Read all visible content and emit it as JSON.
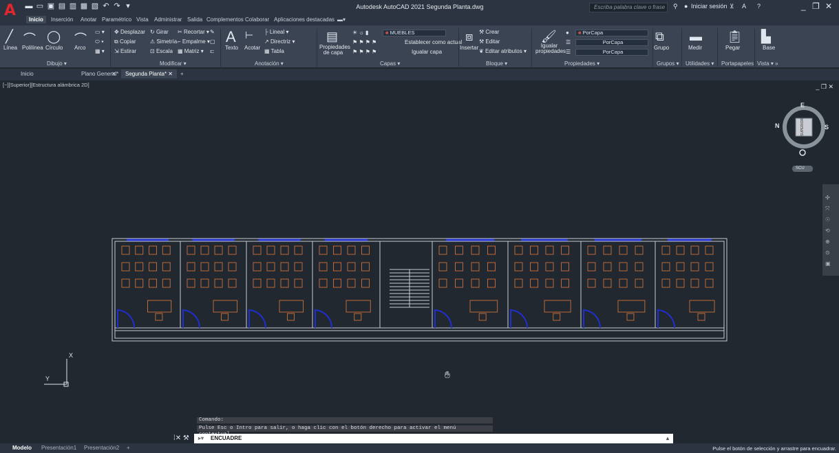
{
  "app": {
    "title": "Autodesk AutoCAD 2021   Segunda Planta.dwg",
    "logo": "A",
    "search_placeholder": "Escriba palabra clave o frase",
    "signin": "Iniciar sesión"
  },
  "ribbon_tabs": [
    "Inicio",
    "Inserción",
    "Anotar",
    "Paramétrico",
    "Vista",
    "Administrar",
    "Salida",
    "Complementos",
    "Colaborar",
    "Aplicaciones destacadas"
  ],
  "panels": {
    "dibujo": {
      "label": "Dibujo ▾",
      "tools": [
        "Línea",
        "Polilínea",
        "Círculo",
        "Arco"
      ]
    },
    "modificar": {
      "label": "Modificar ▾",
      "tools": [
        "Desplazar",
        "Girar",
        "Recortar ▾",
        "Copiar",
        "Simetría",
        "Empalme ▾",
        "Estirar",
        "Escala",
        "Matriz ▾"
      ]
    },
    "anotacion": {
      "label": "Anotación ▾",
      "tools": [
        "Texto",
        "Acotar",
        "Lineal ▾",
        "Directriz ▾",
        "Tabla"
      ]
    },
    "capas": {
      "label": "Capas ▾",
      "props_label": "Propiedades de capa",
      "current_layer": "MUEBLES",
      "tools": [
        "Establecer como actual",
        "Igualar capa"
      ]
    },
    "bloque": {
      "label": "Bloque ▾",
      "insert": "Insertar",
      "tools": [
        "Crear",
        "Editar",
        "Editar atributos ▾"
      ]
    },
    "propiedades": {
      "label": "Propiedades ▾",
      "match": "Igualar propiedades",
      "combo": [
        "PorCapa",
        "PorCapa",
        "PorCapa"
      ]
    },
    "grupos": {
      "label": "Grupos ▾",
      "tool": "Grupo"
    },
    "utilidades": {
      "label": "Utilidades ▾",
      "tool": "Medir"
    },
    "portapapeles": {
      "label": "Portapapeles",
      "tool": "Pegar"
    },
    "vista": {
      "label": "Vista ▾ »",
      "tool": "Base"
    }
  },
  "file_tabs": [
    "Inicio",
    "Plano General*",
    "Segunda Planta*"
  ],
  "viewport_label": "[−][Superior][Estructura alámbrica 2D]",
  "viewcube": {
    "face": "SUPERIOR",
    "n": "N",
    "s": "S",
    "e": "E",
    "o": "O",
    "wcs": "SCU"
  },
  "ucs": {
    "x": "X",
    "y": "Y"
  },
  "command": {
    "history": [
      "Comando:",
      "Pulse Esc o Intro para salir, o haga clic con el botón derecho para activar el menú contextual."
    ],
    "current": "ENCUADRE"
  },
  "layout_tabs": [
    "Modelo",
    "Presentación1",
    "Presentación2"
  ],
  "status_message": "Pulse el botón de selección y arrastre para encuadrar."
}
